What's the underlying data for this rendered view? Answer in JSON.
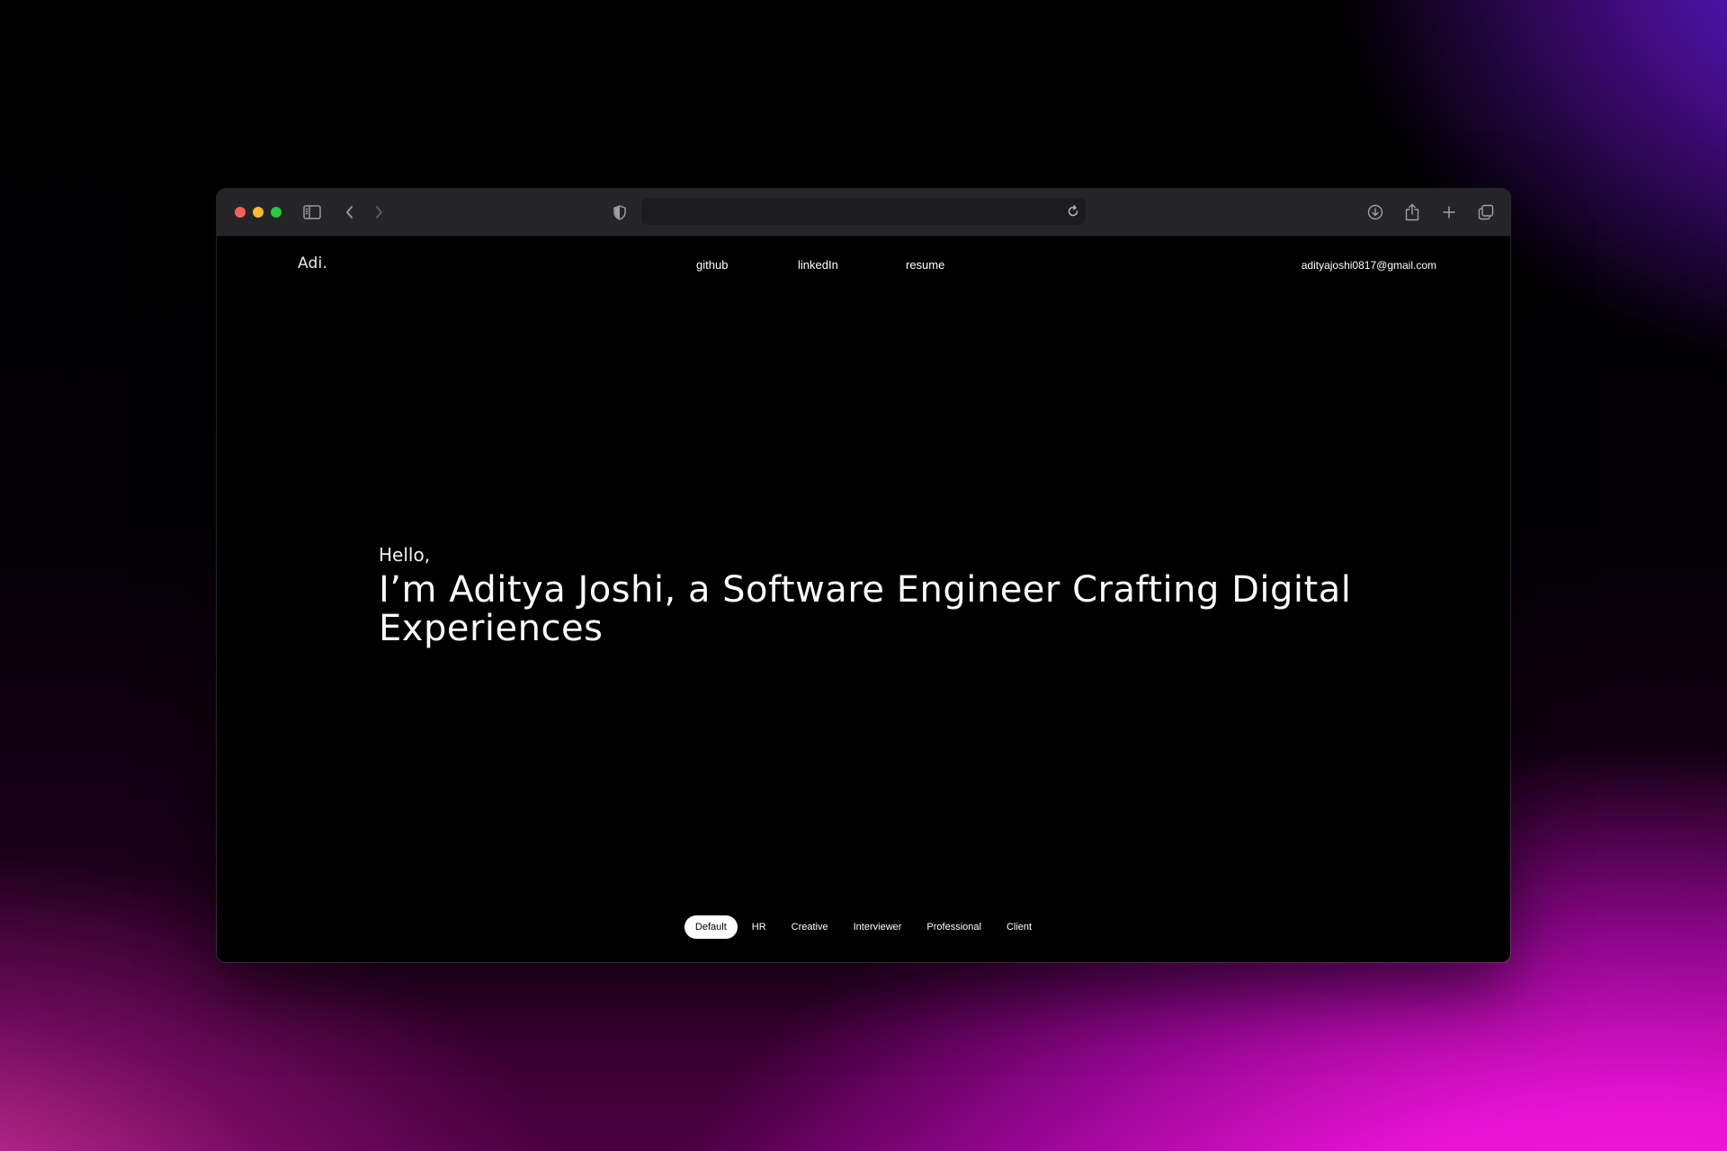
{
  "browser": {
    "address_text": "",
    "icons": {
      "sidebar": "sidebar-icon",
      "back": "chevron-left-icon",
      "forward": "chevron-right-icon",
      "privacy": "shield-icon",
      "reload": "reload-icon",
      "download": "download-icon",
      "share": "share-icon",
      "new_tab": "plus-icon",
      "tab_overview": "tabs-icon"
    }
  },
  "site": {
    "brand": "Adi.",
    "nav": {
      "github": "github",
      "linkedin": "linkedIn",
      "resume": "resume"
    },
    "email": "adityajoshi0817@gmail.com",
    "hero": {
      "greeting": "Hello,",
      "headline": "I’m Aditya Joshi, a Software Engineer Crafting Digital Experiences"
    },
    "modes": [
      {
        "label": "Default",
        "active": true
      },
      {
        "label": "HR",
        "active": false
      },
      {
        "label": "Creative",
        "active": false
      },
      {
        "label": "Interviewer",
        "active": false
      },
      {
        "label": "Professional",
        "active": false
      },
      {
        "label": "Client",
        "active": false
      }
    ]
  },
  "colors": {
    "page_background": "#000000",
    "toolbar": "#252528",
    "accent_pink": "#f21ee0",
    "accent_purple": "#6a28ff"
  }
}
